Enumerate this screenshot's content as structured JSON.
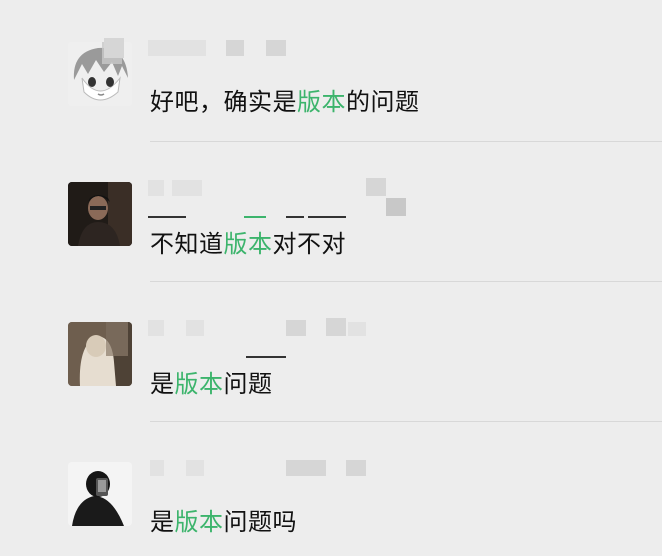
{
  "messages": [
    {
      "segments": [
        "好吧，确实是",
        "版本",
        "的问题"
      ]
    },
    {
      "segments": [
        "不知道",
        "版本",
        "对不对"
      ]
    },
    {
      "segments": [
        "是",
        "版本",
        "问题"
      ]
    },
    {
      "segments": [
        "是",
        "版本",
        "问题吗"
      ]
    }
  ],
  "colors": {
    "highlight": "#3cb46c",
    "background": "#ededed",
    "text": "#111111"
  },
  "icons": [
    "anime-avatar",
    "photo-avatar-dark",
    "photo-avatar-hoodie",
    "photo-avatar-mask"
  ]
}
